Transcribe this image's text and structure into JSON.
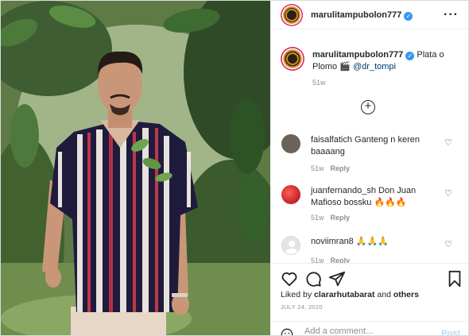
{
  "post_header": {
    "username": "marulitampubolon777",
    "verified_icon": "verified-badge-icon",
    "more_icon": "more-options-icon"
  },
  "caption": {
    "username": "marulitampubolon777",
    "text": "Plata o Plomo",
    "emoji": "🎬",
    "mention": "@dr_tompi",
    "time": "51w"
  },
  "load_more_icon": "plus-circle-icon",
  "comments": [
    {
      "username": "faisalfatich",
      "text": "Ganteng n keren baaaang",
      "time": "51w",
      "reply_label": "Reply",
      "avatar_color": "#6b6259"
    },
    {
      "username": "juanfernando_sh",
      "text": "Don Juan Mafioso bossku 🔥🔥🔥",
      "time": "51w",
      "reply_label": "Reply",
      "avatar_color": "#d32222"
    },
    {
      "username": "noviimran8",
      "text": "🙏🙏🙏",
      "time": "51w",
      "reply_label": "Reply",
      "avatar_color": "#e4e4e4"
    }
  ],
  "actions": {
    "like_icon": "heart-icon",
    "comment_icon": "comment-icon",
    "share_icon": "share-icon",
    "save_icon": "bookmark-icon"
  },
  "likes": {
    "prefix": "Liked by",
    "user": "clararhutabarat",
    "and": "and",
    "others": "others"
  },
  "date": "JULY 24, 2020",
  "add_comment": {
    "placeholder": "Add a comment...",
    "post_label": "Post",
    "emoji_icon": "smiley-icon"
  },
  "colors": {
    "accent": "#3897f0",
    "link": "#00376b",
    "muted": "#8e8e8e",
    "post_disabled": "#b3dbff"
  }
}
